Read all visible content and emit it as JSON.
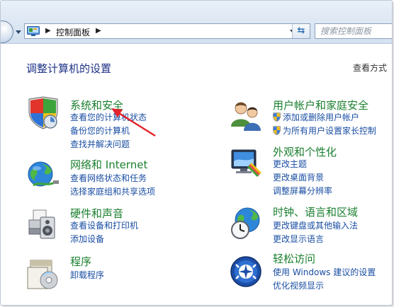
{
  "address_bar": {
    "breadcrumb": "控制面板",
    "separator": "▶"
  },
  "search": {
    "placeholder": "搜索控制面板"
  },
  "page": {
    "title": "调整计算机的设置",
    "view_by": "查看方式"
  },
  "categories": {
    "security": {
      "title": "系统和安全",
      "links": [
        "查看您的计算机状态",
        "备份您的计算机",
        "查找并解决问题"
      ],
      "icon": "shield-icon"
    },
    "network": {
      "title": "网络和 Internet",
      "links": [
        "查看网络状态和任务",
        "选择家庭组和共享选项"
      ],
      "icon": "globe-network-icon"
    },
    "hardware": {
      "title": "硬件和声音",
      "links": [
        "查看设备和打印机",
        "添加设备"
      ],
      "icon": "printer-icon"
    },
    "programs": {
      "title": "程序",
      "links": [
        "卸载程序"
      ],
      "icon": "programs-icon"
    },
    "users": {
      "title": "用户帐户和家庭安全",
      "links": [
        "添加或删除用户帐户",
        "为所有用户设置家长控制"
      ],
      "icon": "users-icon"
    },
    "appearance": {
      "title": "外观和个性化",
      "links": [
        "更改主题",
        "更改桌面背景",
        "调整屏幕分辨率"
      ],
      "icon": "monitor-paint-icon"
    },
    "clock": {
      "title": "时钟、语言和区域",
      "links": [
        "更改键盘或其他输入法",
        "更改显示语言"
      ],
      "icon": "clock-globe-icon"
    },
    "ease": {
      "title": "轻松访问",
      "links": [
        "使用 Windows 建议的设置",
        "优化视频显示"
      ],
      "icon": "ease-of-access-icon"
    }
  },
  "colors": {
    "category_title": "#1a7f2e",
    "link": "#1a4ea3",
    "annotation_arrow": "#e3232c"
  }
}
